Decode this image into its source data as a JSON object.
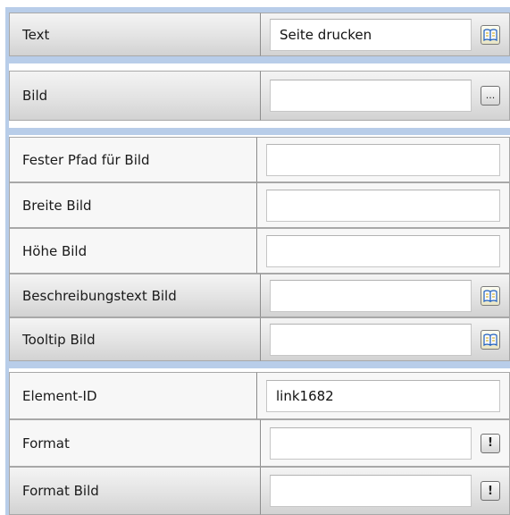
{
  "groups": [
    {
      "rows": [
        {
          "label": "Text",
          "value": "Seite drucken",
          "button": "book-icon"
        }
      ]
    },
    {
      "rows": [
        {
          "label": "Bild",
          "value": "",
          "button": "ellipsis"
        }
      ]
    },
    {
      "rows": [
        {
          "label": "Fester Pfad für Bild",
          "value": ""
        },
        {
          "label": "Breite Bild",
          "value": ""
        },
        {
          "label": "Höhe Bild",
          "value": ""
        },
        {
          "label": "Beschreibungstext Bild",
          "value": "",
          "button": "book-icon"
        },
        {
          "label": "Tooltip Bild",
          "value": "",
          "button": "book-icon"
        }
      ]
    },
    {
      "rows": [
        {
          "label": "Element-ID",
          "value": "link1682"
        },
        {
          "label": "Format",
          "value": "",
          "button": "exclamation-icon"
        },
        {
          "label": "Format Bild",
          "value": "",
          "button": "exclamation-icon"
        }
      ]
    }
  ],
  "symbols": {
    "ellipsis": "...",
    "exclamation": "!"
  },
  "colors": {
    "frame": "#b8cde9",
    "row_gradient_top": "#f4f4f4",
    "row_gradient_bottom": "#d2d2d2",
    "row_plain": "#f7f7f7",
    "book_icon_blue": "#1f5fbf"
  }
}
